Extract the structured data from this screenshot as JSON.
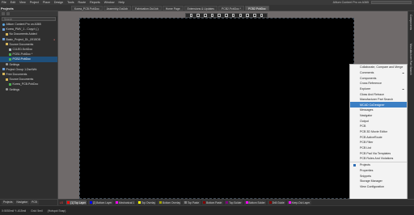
{
  "menubar": {
    "items": [
      "File",
      "Edit",
      "View",
      "Project",
      "Place",
      "Design",
      "Tools",
      "Route",
      "Reports",
      "Window",
      "Help"
    ],
    "app_title": "Altium Content Pro on A365",
    "search_placeholder": "Search"
  },
  "projects_panel": {
    "title": "Projects",
    "search_placeholder": "Search",
    "tree": [
      {
        "label": "Altium Content Pro on A365",
        "level": 0,
        "icon": "cloud-icon"
      },
      {
        "label": "Korea_PMV_1 - Copy.t (-)",
        "level": 0,
        "icon": "project-icon"
      },
      {
        "label": "No Documents Added",
        "level": 1,
        "icon": "folder-icon"
      },
      {
        "label": "Basic_Project_DL_0915O8",
        "level": 0,
        "icon": "project-icon",
        "badge": "●"
      },
      {
        "label": "Source Documents",
        "level": 1,
        "icon": "folder-icon"
      },
      {
        "label": "C1LED.SchDoc",
        "level": 2,
        "icon": "document-icon"
      },
      {
        "label": "PCB1.PcbDoc *",
        "level": 2,
        "icon": "pcb-icon"
      },
      {
        "label": "PCB2.PcbDoc",
        "level": 2,
        "icon": "pcb-icon",
        "selected": true
      },
      {
        "label": "Settings",
        "level": 1,
        "icon": "gear-icon"
      },
      {
        "label": "Project Group 1.DsnWrk",
        "level": 0,
        "icon": "project-icon"
      },
      {
        "label": "Free Documents",
        "level": 0,
        "icon": "folder-icon"
      },
      {
        "label": "Source Documents",
        "level": 1,
        "icon": "folder-icon"
      },
      {
        "label": "Korea_PCB.PcbDoc",
        "level": 2,
        "icon": "pcb-icon"
      },
      {
        "label": "Settings",
        "level": 1,
        "icon": "gear-icon"
      }
    ]
  },
  "document_tabs": [
    {
      "label": "Korea_PCB.PcbDoc",
      "active": false
    },
    {
      "label": "Assembly.OutJob",
      "active": false
    },
    {
      "label": "Fabrication.OutJob",
      "active": false
    },
    {
      "label": "Home Page",
      "active": false
    },
    {
      "label": "Extensions & Updates",
      "active": false
    },
    {
      "label": "PCB2.PcbDoc *",
      "active": false
    },
    {
      "label": "PCB2.PcbDoc",
      "active": true
    }
  ],
  "right_strip": {
    "labels": [
      "Components",
      "Manufacturer Part Search"
    ]
  },
  "panels_menu": {
    "items": [
      {
        "label": "Collaborate, Compare and Merge"
      },
      {
        "label": "Comments",
        "cloud": true
      },
      {
        "label": "Components"
      },
      {
        "label": "Cross Reference"
      },
      {
        "label": "Explorer",
        "cloud": true
      },
      {
        "label": "Gloss And Retrace"
      },
      {
        "label": "Manufacturer Part Search"
      },
      {
        "label": "MCAD CoDesigner",
        "highlighted": true
      },
      {
        "label": "Messages"
      },
      {
        "label": "Navigator"
      },
      {
        "label": "Output"
      },
      {
        "label": "PCB"
      },
      {
        "label": "PCB 3D Movie Editor"
      },
      {
        "label": "PCB ActiveRoute"
      },
      {
        "label": "PCB Filter"
      },
      {
        "label": "PCB List"
      },
      {
        "label": "PCB Pad Via Templates"
      },
      {
        "label": "PCB Rules And Violations"
      },
      {
        "label": "Projects",
        "checked": true
      },
      {
        "label": "Properties"
      },
      {
        "label": "Snippets"
      },
      {
        "label": "Storage Manager"
      },
      {
        "label": "View Configuration"
      }
    ]
  },
  "layer_bar": {
    "ls_label": "LS",
    "layers": [
      {
        "label": "[1] Top Layer",
        "color": "#ff0000",
        "active": true
      },
      {
        "label": "[2] Bottom Layer",
        "color": "#0000ff"
      },
      {
        "label": "Mechanical 1",
        "color": "#ff00ff"
      },
      {
        "label": "Top Overlay",
        "color": "#ffff00"
      },
      {
        "label": "Bottom Overlay",
        "color": "#a0a000"
      },
      {
        "label": "Top Paste",
        "color": "#808080"
      },
      {
        "label": "Bottom Paste",
        "color": "#800000"
      },
      {
        "label": "Top Solder",
        "color": "#800080"
      },
      {
        "label": "Bottom Solder",
        "color": "#ff00ff"
      },
      {
        "label": "Drill Guide",
        "color": "#800000"
      },
      {
        "label": "Keep-Out Layer",
        "color": "#ff00ff"
      }
    ]
  },
  "bottom_left_tabs": [
    "Projects",
    "Navigator",
    "PCB"
  ],
  "status_bar": {
    "coords": "X:5050mil Y:-615mil",
    "grid": "Grid: 5mil",
    "snap": "(Hotspot Snap)"
  }
}
